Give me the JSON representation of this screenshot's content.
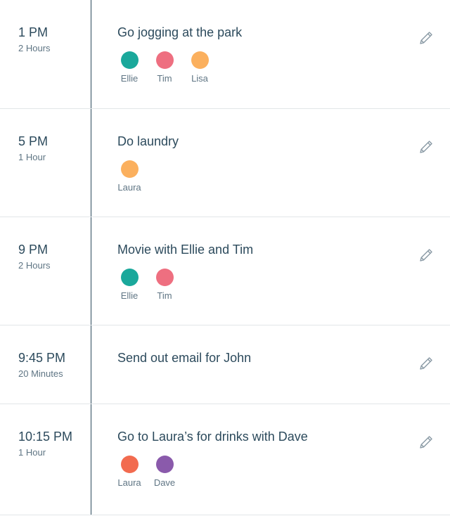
{
  "events": [
    {
      "time": "1 PM",
      "duration": "2 Hours",
      "title": "Go jogging at the park",
      "people": [
        {
          "name": "Ellie",
          "color": "#1aa89b"
        },
        {
          "name": "Tim",
          "color": "#ee6f80"
        },
        {
          "name": "Lisa",
          "color": "#fbb05e"
        }
      ]
    },
    {
      "time": "5 PM",
      "duration": "1 Hour",
      "title": "Do laundry",
      "people": [
        {
          "name": "Laura",
          "color": "#fbb05e"
        }
      ]
    },
    {
      "time": "9 PM",
      "duration": "2 Hours",
      "title": "Movie with Ellie and Tim",
      "people": [
        {
          "name": "Ellie",
          "color": "#1aa89b"
        },
        {
          "name": "Tim",
          "color": "#ee6f80"
        }
      ]
    },
    {
      "time": "9:45 PM",
      "duration": "20 Minutes",
      "title": "Send out email for John",
      "people": []
    },
    {
      "time": "10:15 PM",
      "duration": "1 Hour",
      "title": "Go to Laura’s for drinks with Dave",
      "people": [
        {
          "name": "Laura",
          "color": "#f26b4f"
        },
        {
          "name": "Dave",
          "color": "#8a5aab"
        }
      ]
    }
  ],
  "icons": {
    "edit": "pencil-icon"
  }
}
